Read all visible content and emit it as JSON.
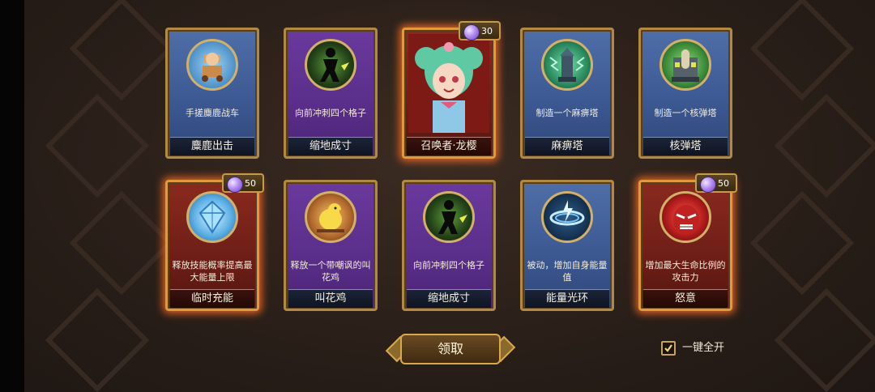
{
  "cards": [
    {
      "id": "c1",
      "name": "麋鹿出击",
      "desc": "手搓麋鹿战车",
      "theme": "blue",
      "cost": null
    },
    {
      "id": "c2",
      "name": "缩地成寸",
      "desc": "向前冲刺四个格子",
      "theme": "purple",
      "cost": null
    },
    {
      "id": "c3",
      "name": "召唤者·龙樱",
      "desc": "",
      "theme": "red",
      "cost": "30"
    },
    {
      "id": "c4",
      "name": "麻痹塔",
      "desc": "制造一个麻痹塔",
      "theme": "blue",
      "cost": null
    },
    {
      "id": "c5",
      "name": "核弹塔",
      "desc": "制造一个核弹塔",
      "theme": "blue",
      "cost": null
    },
    {
      "id": "c6",
      "name": "临时充能",
      "desc": "释放技能概率提高最大能量上限",
      "theme": "red",
      "cost": "50"
    },
    {
      "id": "c7",
      "name": "叫花鸡",
      "desc": "释放一个带嘲讽的叫花鸡",
      "theme": "purple",
      "cost": null
    },
    {
      "id": "c8",
      "name": "缩地成寸",
      "desc": "向前冲刺四个格子",
      "theme": "purple",
      "cost": null
    },
    {
      "id": "c9",
      "name": "能量光环",
      "desc": "被动，增加自身能量值",
      "theme": "blue",
      "cost": null
    },
    {
      "id": "c10",
      "name": "怒意",
      "desc": "增加最大生命比例的攻击力",
      "theme": "red",
      "cost": "50"
    }
  ],
  "card_icons": {
    "c1": "reindeer-chariot-icon",
    "c2": "dash-silhouette-icon",
    "c3": "summoner-portrait-icon",
    "c4": "paralysis-tower-icon",
    "c5": "nuke-tower-icon",
    "c6": "energy-crystal-icon",
    "c7": "chicken-icon",
    "c8": "dash-silhouette-icon",
    "c9": "energy-ring-icon",
    "c10": "rage-face-icon"
  },
  "claim_button": {
    "label": "领取"
  },
  "auto_open": {
    "label": "一键全开",
    "checked": true
  },
  "colors": {
    "accent_gold": "#d9a84b",
    "glow": "#ff6e28",
    "gem": "#b58cf0"
  }
}
